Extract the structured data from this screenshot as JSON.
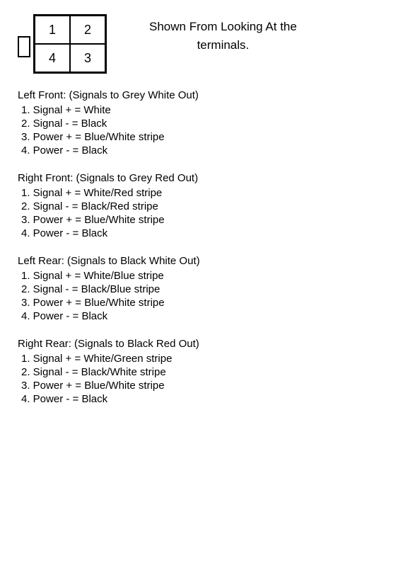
{
  "header": {
    "title_line1": "Shown From Looking At the",
    "title_line2": "terminals.",
    "diagram": {
      "cells": [
        "1",
        "2",
        "4",
        "3"
      ]
    }
  },
  "sections": [
    {
      "title": "Left Front: (Signals to Grey White Out)",
      "items": [
        "1. Signal + = White",
        "2. Signal - = Black",
        "3. Power + = Blue/White stripe",
        "4. Power - = Black"
      ]
    },
    {
      "title": "Right Front: (Signals to Grey Red Out)",
      "items": [
        "1. Signal + = White/Red stripe",
        "2. Signal - = Black/Red stripe",
        "3. Power + = Blue/White stripe",
        "4. Power - = Black"
      ]
    },
    {
      "title": "Left Rear: (Signals to Black White Out)",
      "items": [
        "1. Signal + = White/Blue stripe",
        "2. Signal - = Black/Blue stripe",
        "3. Power + = Blue/White stripe",
        "4. Power - = Black"
      ]
    },
    {
      "title": "Right Rear: (Signals to Black Red Out)",
      "items": [
        "1. Signal + = White/Green stripe",
        "2. Signal - = Black/White stripe",
        "3. Power + = Blue/White stripe",
        "4. Power - = Black"
      ]
    }
  ]
}
